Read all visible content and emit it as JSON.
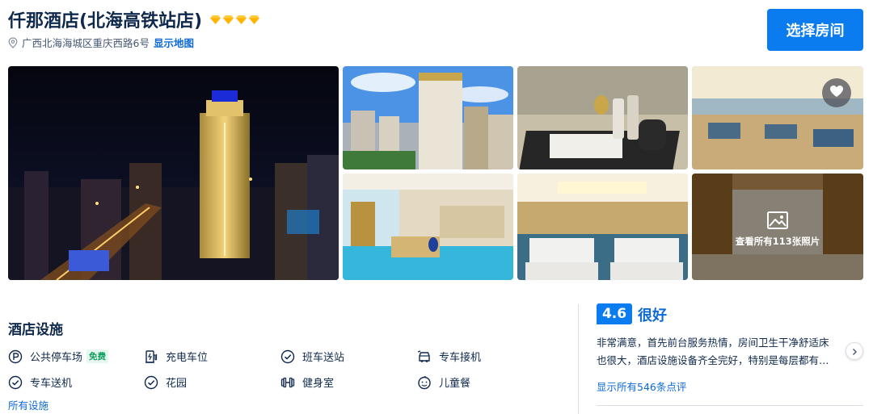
{
  "header": {
    "hotel_name": "仟那酒店(北海高铁站店)",
    "address": "广西北海海城区重庆西路6号",
    "show_map": "显示地图",
    "select_room": "选择房间",
    "rating_diamonds": 4,
    "diamond_color": "#ffb400"
  },
  "gallery": {
    "view_all_photos": "查看所有113张照片"
  },
  "facilities": {
    "title": "酒店设施",
    "items": [
      {
        "label": "公共停车场",
        "icon": "parking-icon",
        "badge": "免费"
      },
      {
        "label": "充电车位",
        "icon": "charging-station-icon"
      },
      {
        "label": "班车送站",
        "icon": "check-circle-icon"
      },
      {
        "label": "专车接机",
        "icon": "airport-car-icon"
      },
      {
        "label": "专车送机",
        "icon": "check-circle-icon"
      },
      {
        "label": "花园",
        "icon": "check-circle-icon"
      },
      {
        "label": "健身室",
        "icon": "dumbbell-icon"
      },
      {
        "label": "儿童餐",
        "icon": "kids-meal-icon"
      }
    ],
    "all_link": "所有设施"
  },
  "review": {
    "score": "4.6",
    "label": "很好",
    "text_line1": "非常满意，首先前台服务热情，房间卫生干净舒适床",
    "text_line2": "也很大，酒店设施设备齐全完好，特别是每层都有…",
    "all_link": "显示所有546条点评"
  },
  "colors": {
    "brand_blue": "#0b7cf0",
    "link_blue": "#0e6ad4",
    "text_dark": "#0f294d",
    "free_green": "#0b9e5b"
  }
}
